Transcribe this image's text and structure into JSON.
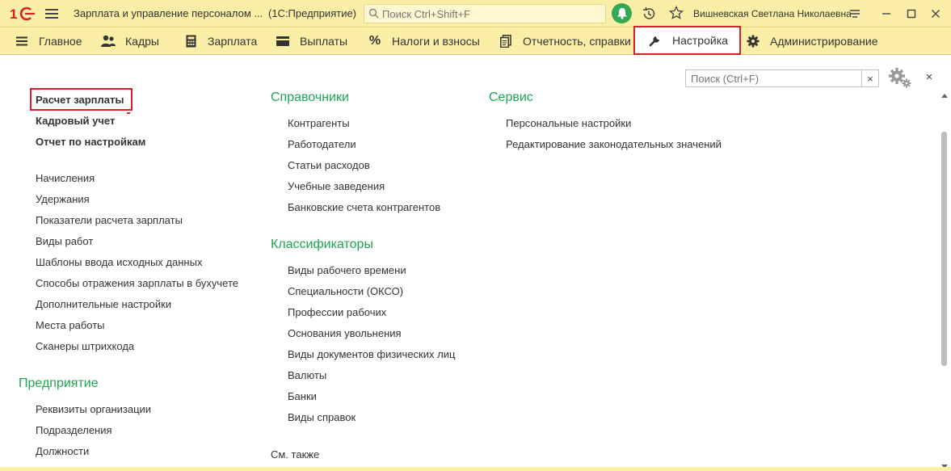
{
  "titlebar": {
    "title": "Зарплата и управление персоналом ...",
    "subtitle": "(1С:Предприятие)",
    "search_placeholder": "Поиск Ctrl+Shift+F",
    "user": "Вишневская Светлана Николаевна"
  },
  "sections": [
    {
      "label": "Главное",
      "icon": "menu-icon"
    },
    {
      "label": "Кадры",
      "icon": "people-icon"
    },
    {
      "label": "Зарплата",
      "icon": "calculator-icon"
    },
    {
      "label": "Выплаты",
      "icon": "wallet-icon"
    },
    {
      "label": "Налоги и взносы",
      "icon": "percent-icon"
    },
    {
      "label": "Отчетность, справки",
      "icon": "reports-icon"
    },
    {
      "label": "Настройка",
      "icon": "wrench-icon",
      "active": true
    },
    {
      "label": "Администрирование",
      "icon": "gear-icon"
    }
  ],
  "panel": {
    "search_placeholder": "Поиск (Ctrl+F)",
    "clear_label": "×",
    "close_label": "×"
  },
  "col1": {
    "bold": [
      "Расчет зарплаты",
      "Кадровый учет",
      "Отчет по настройкам"
    ],
    "items": [
      "Начисления",
      "Удержания",
      "Показатели расчета зарплаты",
      "Виды работ",
      "Шаблоны ввода исходных данных",
      "Способы отражения зарплаты в бухучете",
      "Дополнительные настройки",
      "Места работы",
      "Сканеры штрихкода"
    ],
    "group2_title": "Предприятие",
    "group2_items": [
      "Реквизиты организации",
      "Подразделения",
      "Должности"
    ]
  },
  "col2": {
    "group1_title": "Справочники",
    "group1_items": [
      "Контрагенты",
      "Работодатели",
      "Статьи расходов",
      "Учебные заведения",
      "Банковские счета контрагентов"
    ],
    "group2_title": "Классификаторы",
    "group2_items": [
      "Виды рабочего времени",
      "Специальности (ОКСО)",
      "Профессии рабочих",
      "Основания увольнения",
      "Виды документов физических лиц",
      "Валюты",
      "Банки",
      "Виды справок"
    ],
    "see_also": "См. также"
  },
  "col3": {
    "group1_title": "Сервис",
    "group1_items": [
      "Персональные настройки",
      "Редактирование законодательных значений"
    ]
  },
  "colors": {
    "bar_bg": "#fbeea6",
    "group_title": "#1ea552",
    "highlight": "#d9202a",
    "bell": "#34a853"
  }
}
